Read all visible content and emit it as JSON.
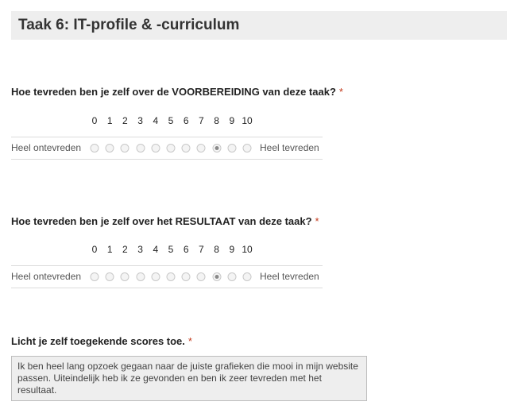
{
  "section": {
    "title": "Taak 6: IT-profile & -curriculum"
  },
  "questions": [
    {
      "text": "Hoe tevreden ben je zelf over de VOORBEREIDING van deze taak?",
      "required_mark": "*",
      "scale": [
        "0",
        "1",
        "2",
        "3",
        "4",
        "5",
        "6",
        "7",
        "8",
        "9",
        "10"
      ],
      "left_label": "Heel ontevreden",
      "right_label": "Heel tevreden",
      "selected_value": 8
    },
    {
      "text": "Hoe tevreden ben je zelf over het RESULTAAT van deze taak?",
      "required_mark": "*",
      "scale": [
        "0",
        "1",
        "2",
        "3",
        "4",
        "5",
        "6",
        "7",
        "8",
        "9",
        "10"
      ],
      "left_label": "Heel ontevreden",
      "right_label": "Heel tevreden",
      "selected_value": 8
    },
    {
      "text": "Licht je zelf toegekende scores toe.",
      "required_mark": "*",
      "answer": "Ik ben heel lang opzoek gegaan naar de juiste grafieken die mooi in mijn website passen. Uiteindelijk heb ik ze gevonden en ben ik zeer tevreden met het resultaat."
    }
  ]
}
